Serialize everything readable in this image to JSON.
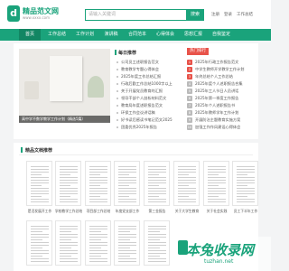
{
  "header": {
    "logo_mark": "d",
    "logo_title": "精品范文网",
    "logo_sub": "www.xxxx.com",
    "search_placeholder": "请输入关键词",
    "search_button": "搜索",
    "links": [
      "注册",
      "登录",
      "工作总结"
    ]
  },
  "nav": {
    "items": [
      "首页",
      "工作总结",
      "工作计划",
      "演讲稿",
      "合同范本",
      "心得体会",
      "思想汇报",
      "自我鉴定"
    ],
    "active_index": 0
  },
  "banner": {
    "caption": "高中学不数学教学工作计划（精选5篇）"
  },
  "latest": {
    "title": "每日推荐",
    "items": [
      "公司员工述职报告范文",
      "教育教学专题心得体会",
      "2025年度工作总结汇报",
      "行政后勤工作总结1000字以上",
      "关于开展党员教育的汇报",
      "领导干部个人剖析材料范文",
      "教育局年度述职报告范文",
      "环保工作会议讲话稿",
      "好书读后感读书笔记范文2025",
      "团委优秀2025年报告"
    ]
  },
  "hot": {
    "title": "热门排行",
    "items": [
      "2025年行政工作报告范文",
      "中学生教师开学教学工作计划",
      "年终总结个人工作总结",
      "2025年度个人述职报告合集",
      "2025年工人节日人员讲话",
      "2025年第一季度工作报告",
      "2025年个人述职报告书",
      "2025年教师学年工作计划",
      "开展防治主题教育实施方案",
      "加强工作作风建设心得体会"
    ]
  },
  "docs": {
    "title": "精品文档推荐",
    "items": [
      "是活发展开工作",
      "学校教学工作总结",
      "项目部工作总结",
      "年度党支部工作",
      "第三金报告",
      "关于大学生教育",
      "关于社会实践",
      "员工下半年工作"
    ]
  },
  "watermark": {
    "title": "本兔收录网",
    "sub": "tuzhan.net"
  },
  "colors": {
    "brand": "#1aa37b",
    "nav_active": "#128663",
    "hot": "#e8534a"
  }
}
